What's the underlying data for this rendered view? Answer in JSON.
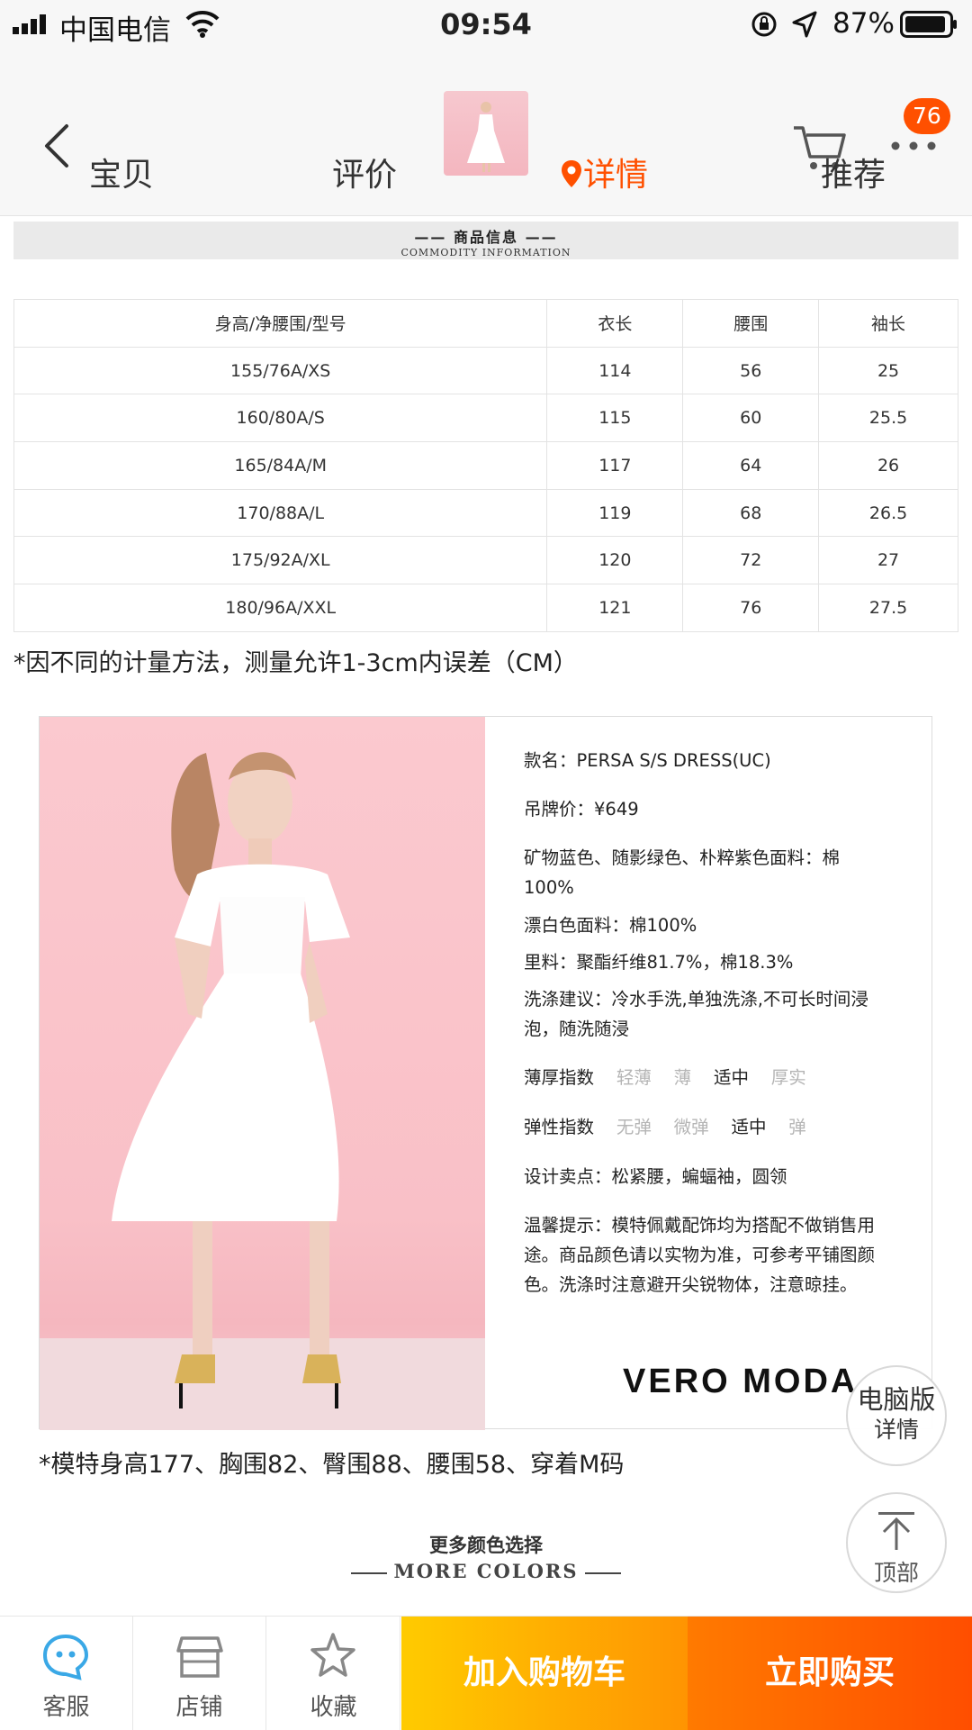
{
  "status_bar": {
    "carrier": "中国电信",
    "time": "09:54",
    "battery": "87%"
  },
  "header": {
    "badge_count": "76"
  },
  "tabs": [
    {
      "label": "宝贝"
    },
    {
      "label": "评价"
    },
    {
      "label": "详情"
    },
    {
      "label": "推荐"
    }
  ],
  "info_banner": {
    "title": "—— 商品信息 ——",
    "subtitle": "COMMODITY INFORMATION"
  },
  "size_table": {
    "headers": [
      "身高/净腰围/型号",
      "衣长",
      "腰围",
      "袖长"
    ],
    "rows": [
      [
        "155/76A/XS",
        "114",
        "56",
        "25"
      ],
      [
        "160/80A/S",
        "115",
        "60",
        "25.5"
      ],
      [
        "165/84A/M",
        "117",
        "64",
        "26"
      ],
      [
        "170/88A/L",
        "119",
        "68",
        "26.5"
      ],
      [
        "175/92A/XL",
        "120",
        "72",
        "27"
      ],
      [
        "180/96A/XXL",
        "121",
        "76",
        "27.5"
      ]
    ]
  },
  "measure_note": "*因不同的计量方法，测量允许1-3cm内误差（CM）",
  "product": {
    "name": "款名：PERSA S/S DRESS(UC)",
    "price": "吊牌价：¥649",
    "fabric1": "矿物蓝色、随影绿色、朴粹紫色面料：棉100%",
    "fabric2": "漂白色面料：棉100%",
    "lining": "里料：聚酯纤维81.7%，棉18.3%",
    "wash": "洗涤建议：冷水手洗,单独洗涤,不可长时间浸泡，随洗随浸",
    "thickness": {
      "label": "薄厚指数",
      "options": [
        "轻薄",
        "薄",
        "适中",
        "厚实"
      ],
      "selected": 2
    },
    "elasticity": {
      "label": "弹性指数",
      "options": [
        "无弹",
        "微弹",
        "适中",
        "弹"
      ],
      "selected": 2
    },
    "design": "设计卖点：松紧腰，蝙蝠袖，圆领",
    "tips": "温馨提示：模特佩戴配饰均为搭配不做销售用途。商品颜色请以实物为准，可参考平铺图颜色。洗涤时注意避开尖锐物体，注意晾挂。",
    "brand": "VERO MODA"
  },
  "model_note": "*模特身高177、胸围82、臀围88、腰围58、穿着M码",
  "more_colors": {
    "cn": "更多颜色选择",
    "en": "MORE COLORS"
  },
  "float_buttons": {
    "pc_line1": "电脑版",
    "pc_line2": "详情",
    "top": "顶部"
  },
  "bottom_bar": {
    "service": "客服",
    "shop": "店铺",
    "favorite": "收藏",
    "add_cart": "加入购物车",
    "buy_now": "立即购买"
  },
  "colors": {
    "accent": "#ff5000",
    "cart_button": "#ffb400",
    "buy_button": "#ff5a00"
  }
}
